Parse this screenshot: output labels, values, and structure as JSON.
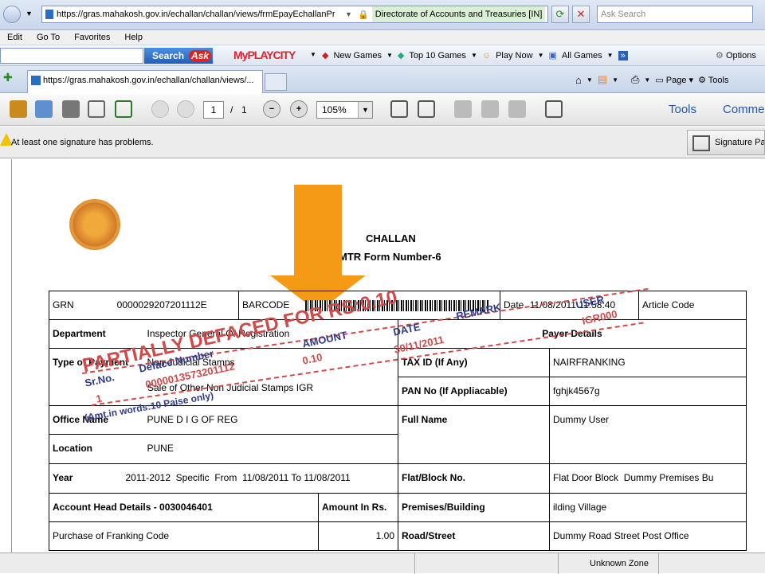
{
  "browser": {
    "url": "https://gras.mahakosh.gov.in/echallan/challan/views/frmEpayEchallanPr",
    "site_identity": "Directorate of Accounts and Treasuries [IN]",
    "search_placeholder": "Ask Search",
    "menu": [
      "Edit",
      "Go To",
      "Favorites",
      "Help"
    ],
    "ask_button": "Search",
    "ask_brand": "Ask",
    "toolbar_links": [
      "New Games",
      "Top 10 Games",
      "Play Now",
      "All Games"
    ],
    "options": "Options",
    "tab_title": "https://gras.mahakosh.gov.in/echallan/challan/views/...",
    "cmd": {
      "page": "Page",
      "tools": "Tools"
    }
  },
  "pdf": {
    "page_current": "1",
    "page_sep": "/",
    "page_total": "1",
    "zoom": "105%",
    "tools_label": "Tools",
    "comment_label": "Comme",
    "sig_msg": "At least one signature has problems.",
    "sig_panel": "Signature Pa"
  },
  "challan": {
    "title": "CHALLAN",
    "form": "MTR Form Number-6",
    "grn_label": "GRN",
    "grn": "0000029207201112E",
    "barcode_label": "BARCODE",
    "date_label": "Date",
    "date_value": "11/08/2011 11:58:40",
    "article_label": "Article Code",
    "dept_label": "Department",
    "dept": "Inspector General Of Registration",
    "payer_label": "Payer Details",
    "type_label": "Type of Payment",
    "type_1": "Non-Judicial Stamps",
    "type_2": "Sale of Other Non Judicial Stamps IGR",
    "tax_label": "TAX ID (If Any)",
    "tax": "NAIRFRANKING",
    "pan_label": "PAN No (If Appliacable)",
    "pan": "fghjk4567g",
    "office_label": "Office Name",
    "office": "PUNE D I G OF REG",
    "fullname_label": "Full Name",
    "fullname": "Dummy User",
    "location_label": "Location",
    "location": "PUNE",
    "year_label": "Year",
    "year": "2011-2012  Specific  From  11/08/2011 To 11/08/2011",
    "flat_label": "Flat/Block No.",
    "flat": "Flat Door Block  Dummy Premises Bu",
    "acc_label": "Account Head Details - 0030046401",
    "amount_label": "Amount In Rs.",
    "premises_label": "Premises/Building",
    "premises": "ilding Village",
    "purchase_label": "Purchase of Franking Code",
    "purchase_amount": "1.00",
    "road_label": "Road/Street",
    "road": "Dummy Road Street Post Office"
  },
  "deface_stamp": {
    "headline": "PARTIALLY DEFACED FOR RS:0.10",
    "srno_label": "Sr.No.",
    "srno": "1",
    "deface_label": "Deface Number",
    "deface": "0000013573201112",
    "amount_label": "AMOUNT",
    "amount": "0.10",
    "date_label": "DATE",
    "date": "30/11/2011",
    "remark_label": "REMARK",
    "user_label": "USER",
    "user": "IGR000",
    "words": "(Amt.in words:10 Paise only)"
  },
  "status": {
    "zone": "Unknown Zone"
  },
  "colors": {
    "arrow": "#f59a16",
    "stamp_red": "#d04a4a",
    "stamp_blue": "#2d3a8a"
  }
}
